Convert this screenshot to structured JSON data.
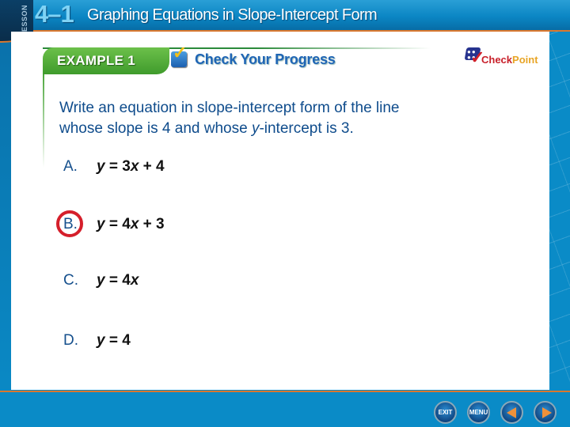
{
  "header": {
    "lesson_label": "LESSON",
    "lesson_number": "4–1",
    "title": "Graphing Equations in Slope-Intercept Form"
  },
  "banner": {
    "example_label": "EXAMPLE 1",
    "check_label": "Check Your Progress",
    "logo_check": "Check",
    "logo_point": "Point"
  },
  "question": {
    "line1": "Write an equation in slope-intercept form of the line",
    "line2_pre": "whose slope is 4 and whose ",
    "line2_var": "y",
    "line2_post": "-intercept is 3."
  },
  "answers": [
    {
      "letter": "A.",
      "y": "y",
      "eq": " = 3",
      "x": "x",
      "rest": " + 4",
      "correct": false
    },
    {
      "letter": "B.",
      "y": "y",
      "eq": " = 4",
      "x": "x",
      "rest": " + 3",
      "correct": true
    },
    {
      "letter": "C.",
      "y": "y",
      "eq": " = 4",
      "x": "x",
      "rest": "",
      "correct": false
    },
    {
      "letter": "D.",
      "y": "y",
      "eq": " = 4",
      "x": "",
      "rest": "",
      "correct": false
    }
  ],
  "nav": {
    "exit_label": "EXIT",
    "menu_label": "MENU",
    "prev_icon": "triangle-left",
    "next_icon": "triangle-right"
  },
  "colors": {
    "header_blue": "#0b86c4",
    "accent_orange": "#d9782f",
    "example_green": "#3f9b2c",
    "question_blue": "#0f4c8c",
    "correct_ring_red": "#d51f2b"
  }
}
